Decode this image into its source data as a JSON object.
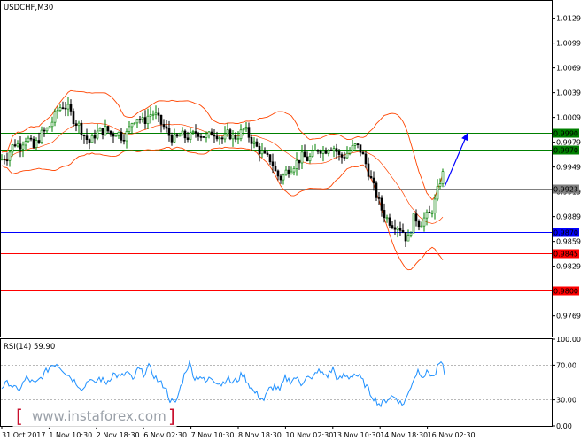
{
  "chart_data": {
    "type": "candlestick",
    "title": "USDCHF,M30",
    "y_ticks": [
      "1.0129",
      "1.0099",
      "1.0069",
      "1.0039",
      "1.0009",
      "0.9979",
      "0.9949",
      "0.9919",
      "0.9889",
      "0.9859",
      "0.9829",
      "0.9769"
    ],
    "ylim": [
      0.9744,
      1.015
    ],
    "levels": [
      {
        "name": "resistance-2",
        "value": 0.999,
        "label": "0.9990",
        "color": "#008000"
      },
      {
        "name": "resistance-1",
        "value": 0.997,
        "label": "0.9970",
        "color": "#008000"
      },
      {
        "name": "current",
        "value": 0.9923,
        "label": "0.9923",
        "color": "#808080"
      },
      {
        "name": "pivot",
        "value": 0.987,
        "label": "0.9870",
        "color": "#0000ff"
      },
      {
        "name": "support-1",
        "value": 0.9845,
        "label": "0.9845",
        "color": "#ff0000"
      },
      {
        "name": "support-2",
        "value": 0.98,
        "label": "0.9800",
        "color": "#ff0000"
      }
    ],
    "x_ticks": [
      "31 Oct 2017",
      "1 Nov 10:30",
      "2 Nov 18:30",
      "6 Nov 02:30",
      "7 Nov 10:30",
      "8 Nov 18:30",
      "10 Nov 02:30",
      "13 Nov 10:30",
      "14 Nov 18:30",
      "16 Nov 02:30"
    ],
    "price_path": [
      [
        0,
        0.9958
      ],
      [
        8,
        0.9962
      ],
      [
        16,
        0.9978
      ],
      [
        22,
        0.9975
      ],
      [
        30,
        0.9985
      ],
      [
        38,
        0.9972
      ],
      [
        46,
        0.9988
      ],
      [
        54,
        0.9995
      ],
      [
        60,
        1.0006
      ],
      [
        66,
        1.002
      ],
      [
        72,
        1.0024
      ],
      [
        78,
        1.0018
      ],
      [
        84,
        1.0005
      ],
      [
        90,
        0.9998
      ],
      [
        96,
        0.9985
      ],
      [
        102,
        0.9978
      ],
      [
        108,
        0.999
      ],
      [
        114,
        0.9992
      ],
      [
        120,
        0.9995
      ],
      [
        126,
        0.9988
      ],
      [
        132,
        0.9992
      ],
      [
        138,
        0.9985
      ],
      [
        144,
        0.999
      ],
      [
        150,
        1.0006
      ],
      [
        156,
        1.001
      ],
      [
        162,
        1.0003
      ],
      [
        168,
        1.0012
      ],
      [
        174,
        1.0014
      ],
      [
        180,
        1.0004
      ],
      [
        186,
        0.9996
      ],
      [
        192,
        0.9986
      ],
      [
        198,
        0.9982
      ],
      [
        204,
        0.9988
      ],
      [
        210,
        0.9985
      ],
      [
        216,
        0.9986
      ],
      [
        222,
        0.9992
      ],
      [
        228,
        0.9988
      ],
      [
        234,
        0.9984
      ],
      [
        240,
        0.9992
      ],
      [
        246,
        0.9988
      ],
      [
        252,
        0.9982
      ],
      [
        258,
        0.999
      ],
      [
        264,
        0.9984
      ],
      [
        270,
        0.9988
      ],
      [
        276,
        0.9995
      ],
      [
        282,
        0.9985
      ],
      [
        288,
        0.9975
      ],
      [
        294,
        0.9968
      ],
      [
        300,
        0.996
      ],
      [
        306,
        0.9958
      ],
      [
        312,
        0.994
      ],
      [
        318,
        0.9935
      ],
      [
        324,
        0.9945
      ],
      [
        330,
        0.995
      ],
      [
        336,
        0.9956
      ],
      [
        342,
        0.9962
      ],
      [
        348,
        0.9958
      ],
      [
        354,
        0.9965
      ],
      [
        360,
        0.9972
      ],
      [
        366,
        0.9968
      ],
      [
        372,
        0.9975
      ],
      [
        378,
        0.9972
      ],
      [
        384,
        0.996
      ],
      [
        390,
        0.9964
      ],
      [
        396,
        0.997
      ],
      [
        402,
        0.9975
      ],
      [
        408,
        0.9968
      ],
      [
        414,
        0.995
      ],
      [
        420,
        0.993
      ],
      [
        426,
        0.9912
      ],
      [
        432,
        0.9895
      ],
      [
        438,
        0.9885
      ],
      [
        444,
        0.988
      ],
      [
        450,
        0.9878
      ],
      [
        456,
        0.987
      ],
      [
        460,
        0.9858
      ],
      [
        464,
        0.9875
      ],
      [
        468,
        0.989
      ],
      [
        474,
        0.988
      ],
      [
        480,
        0.9888
      ],
      [
        486,
        0.9892
      ],
      [
        492,
        0.991
      ],
      [
        496,
        0.993
      ],
      [
        500,
        0.994
      ],
      [
        502,
        0.993
      ]
    ],
    "forecast": [
      [
        502,
        0.9925
      ],
      [
        528,
        0.999
      ]
    ],
    "rsi": {
      "label": "RSI(14) 59.90",
      "y_ticks": [
        "100.00",
        "70.00",
        "30.00",
        "0.00"
      ],
      "levels": [
        70,
        30
      ],
      "values": [
        [
          0,
          44
        ],
        [
          10,
          50
        ],
        [
          20,
          40
        ],
        [
          30,
          55
        ],
        [
          40,
          48
        ],
        [
          50,
          60
        ],
        [
          58,
          70
        ],
        [
          64,
          72
        ],
        [
          70,
          66
        ],
        [
          78,
          58
        ],
        [
          86,
          50
        ],
        [
          94,
          42
        ],
        [
          100,
          55
        ],
        [
          106,
          48
        ],
        [
          112,
          55
        ],
        [
          120,
          50
        ],
        [
          128,
          60
        ],
        [
          136,
          56
        ],
        [
          144,
          62
        ],
        [
          150,
          52
        ],
        [
          156,
          66
        ],
        [
          162,
          60
        ],
        [
          168,
          68
        ],
        [
          174,
          58
        ],
        [
          180,
          50
        ],
        [
          186,
          46
        ],
        [
          192,
          30
        ],
        [
          198,
          25
        ],
        [
          204,
          45
        ],
        [
          210,
          65
        ],
        [
          214,
          72
        ],
        [
          220,
          55
        ],
        [
          226,
          58
        ],
        [
          232,
          50
        ],
        [
          238,
          56
        ],
        [
          244,
          52
        ],
        [
          250,
          48
        ],
        [
          256,
          55
        ],
        [
          262,
          50
        ],
        [
          268,
          53
        ],
        [
          274,
          60
        ],
        [
          280,
          50
        ],
        [
          286,
          40
        ],
        [
          292,
          35
        ],
        [
          298,
          30
        ],
        [
          304,
          42
        ],
        [
          310,
          46
        ],
        [
          316,
          40
        ],
        [
          322,
          55
        ],
        [
          328,
          52
        ],
        [
          334,
          56
        ],
        [
          340,
          48
        ],
        [
          346,
          58
        ],
        [
          352,
          52
        ],
        [
          358,
          64
        ],
        [
          364,
          60
        ],
        [
          370,
          58
        ],
        [
          376,
          66
        ],
        [
          382,
          52
        ],
        [
          388,
          58
        ],
        [
          394,
          56
        ],
        [
          400,
          60
        ],
        [
          406,
          56
        ],
        [
          412,
          48
        ],
        [
          418,
          38
        ],
        [
          424,
          30
        ],
        [
          430,
          24
        ],
        [
          436,
          30
        ],
        [
          442,
          34
        ],
        [
          448,
          32
        ],
        [
          454,
          24
        ],
        [
          460,
          34
        ],
        [
          466,
          52
        ],
        [
          472,
          64
        ],
        [
          478,
          58
        ],
        [
          484,
          62
        ],
        [
          490,
          56
        ],
        [
          496,
          72
        ],
        [
          500,
          68
        ],
        [
          502,
          62
        ]
      ]
    }
  },
  "watermark": {
    "text": "www.instaforex.com",
    "bracket_left": "[",
    "bracket_right": "]"
  }
}
